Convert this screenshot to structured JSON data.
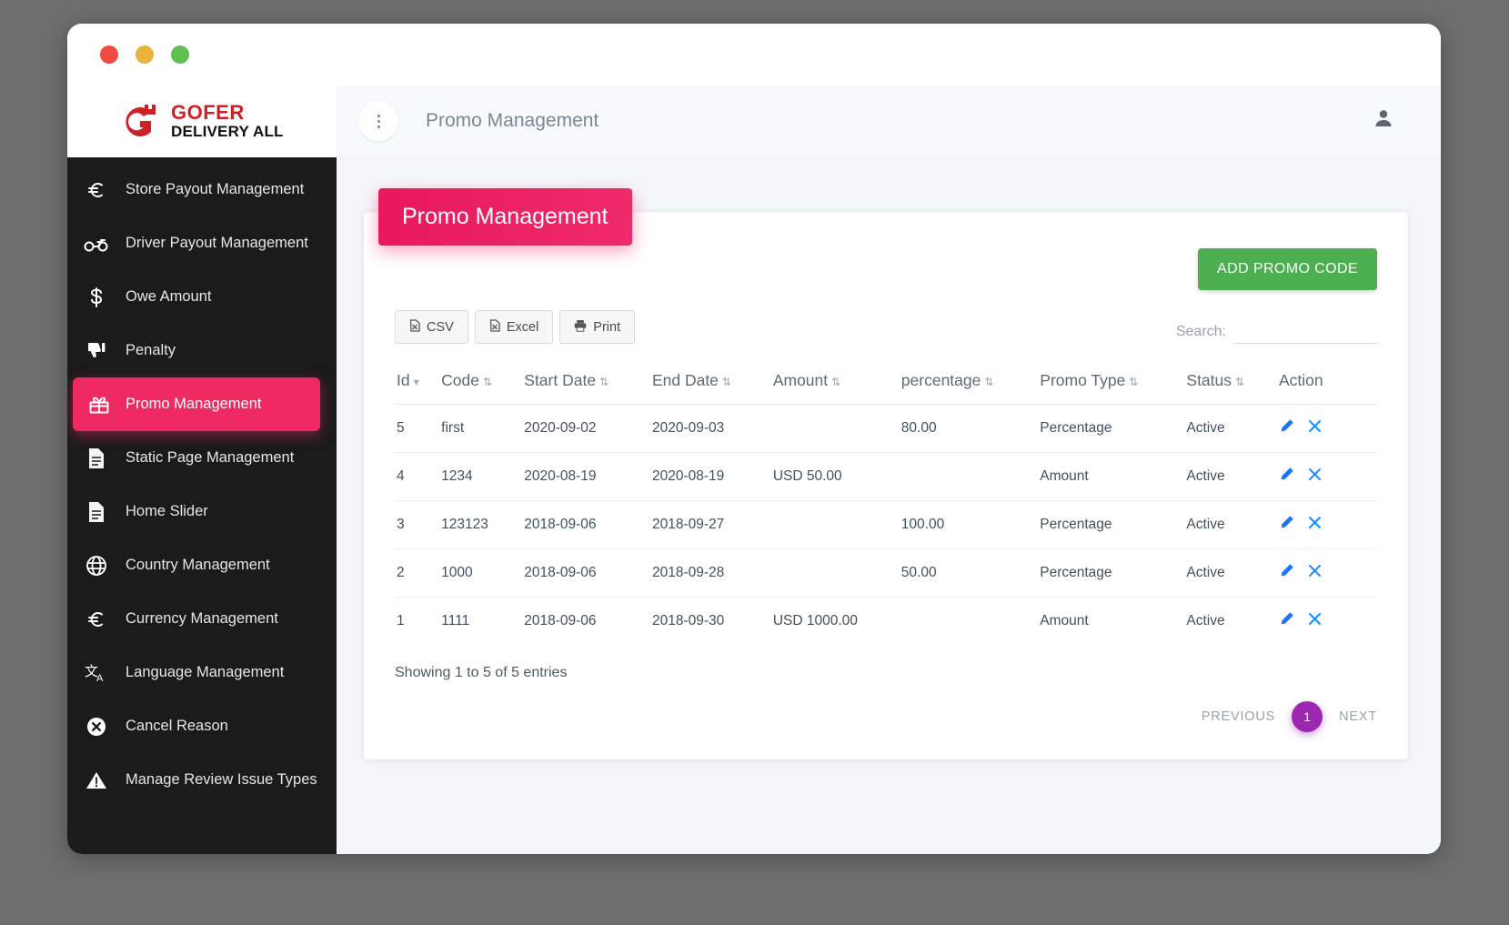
{
  "window": {
    "traffic_lights": [
      "close",
      "minimize",
      "maximize"
    ]
  },
  "brand": {
    "line1": "GOFER",
    "line2": "DELIVERY ALL",
    "logo_color": "#cf2026"
  },
  "sidebar": {
    "items": [
      {
        "label": "Store Payout Management",
        "icon": "euro-icon",
        "glyph": "€",
        "active": false
      },
      {
        "label": "Driver Payout Management",
        "icon": "motorbike-icon",
        "glyph": "⚯",
        "active": false
      },
      {
        "label": "Owe Amount",
        "icon": "dollar-icon",
        "glyph": "$",
        "active": false
      },
      {
        "label": "Penalty",
        "icon": "thumbs-down-icon",
        "glyph": "👎",
        "active": false
      },
      {
        "label": "Promo Management",
        "icon": "gift-icon",
        "glyph": "🎁",
        "active": true
      },
      {
        "label": "Static Page Management",
        "icon": "document-icon",
        "glyph": "📄",
        "active": false
      },
      {
        "label": "Home Slider",
        "icon": "document-icon",
        "glyph": "📄",
        "active": false
      },
      {
        "label": "Country Management",
        "icon": "globe-icon",
        "glyph": "🌐",
        "active": false
      },
      {
        "label": "Currency Management",
        "icon": "euro-icon",
        "glyph": "€",
        "active": false
      },
      {
        "label": "Language Management",
        "icon": "translate-icon",
        "glyph": "文A",
        "active": false
      },
      {
        "label": "Cancel Reason",
        "icon": "cancel-circle-icon",
        "glyph": "✖",
        "active": false
      },
      {
        "label": "Manage Review Issue Types",
        "icon": "warning-triangle-icon",
        "glyph": "⚠",
        "active": false
      }
    ]
  },
  "topbar": {
    "menu_icon": "kebab-menu-icon",
    "title": "Promo Management",
    "user_icon": "user-icon"
  },
  "card": {
    "badge_title": "Promo Management",
    "badge_color": "#e91e63",
    "add_button": "ADD PROMO CODE",
    "add_button_color": "#4caf50",
    "export_buttons": [
      {
        "label": "CSV",
        "icon": "file-export-icon"
      },
      {
        "label": "Excel",
        "icon": "file-export-icon"
      },
      {
        "label": "Print",
        "icon": "printer-icon"
      }
    ],
    "search": {
      "label": "Search:",
      "value": "",
      "placeholder": ""
    }
  },
  "table": {
    "columns": [
      {
        "label": "Id",
        "sort": "desc"
      },
      {
        "label": "Code",
        "sort": "both"
      },
      {
        "label": "Start Date",
        "sort": "both"
      },
      {
        "label": "End Date",
        "sort": "both"
      },
      {
        "label": "Amount",
        "sort": "both"
      },
      {
        "label": "percentage",
        "sort": "both"
      },
      {
        "label": "Promo Type",
        "sort": "both"
      },
      {
        "label": "Status",
        "sort": "both"
      },
      {
        "label": "Action",
        "sort": "none"
      }
    ],
    "rows": [
      {
        "id": "5",
        "code": "first",
        "start_date": "2020-09-02",
        "end_date": "2020-09-03",
        "amount": "",
        "percentage": "80.00",
        "promo_type": "Percentage",
        "status": "Active"
      },
      {
        "id": "4",
        "code": "1234",
        "start_date": "2020-08-19",
        "end_date": "2020-08-19",
        "amount": "USD 50.00",
        "percentage": "",
        "promo_type": "Amount",
        "status": "Active"
      },
      {
        "id": "3",
        "code": "123123",
        "start_date": "2018-09-06",
        "end_date": "2018-09-27",
        "amount": "",
        "percentage": "100.00",
        "promo_type": "Percentage",
        "status": "Active"
      },
      {
        "id": "2",
        "code": "1000",
        "start_date": "2018-09-06",
        "end_date": "2018-09-28",
        "amount": "",
        "percentage": "50.00",
        "promo_type": "Percentage",
        "status": "Active"
      },
      {
        "id": "1",
        "code": "1111",
        "start_date": "2018-09-06",
        "end_date": "2018-09-30",
        "amount": "USD 1000.00",
        "percentage": "",
        "promo_type": "Amount",
        "status": "Active"
      }
    ],
    "action_icons": [
      {
        "name": "edit-icon",
        "glyph": "✏"
      },
      {
        "name": "delete-icon",
        "glyph": "✕"
      }
    ],
    "info": "Showing 1 to 5 of 5 entries",
    "pagination": {
      "previous": "PREVIOUS",
      "pages": [
        "1"
      ],
      "next": "NEXT",
      "active_page": "1",
      "active_color": "#9c27b0"
    }
  }
}
